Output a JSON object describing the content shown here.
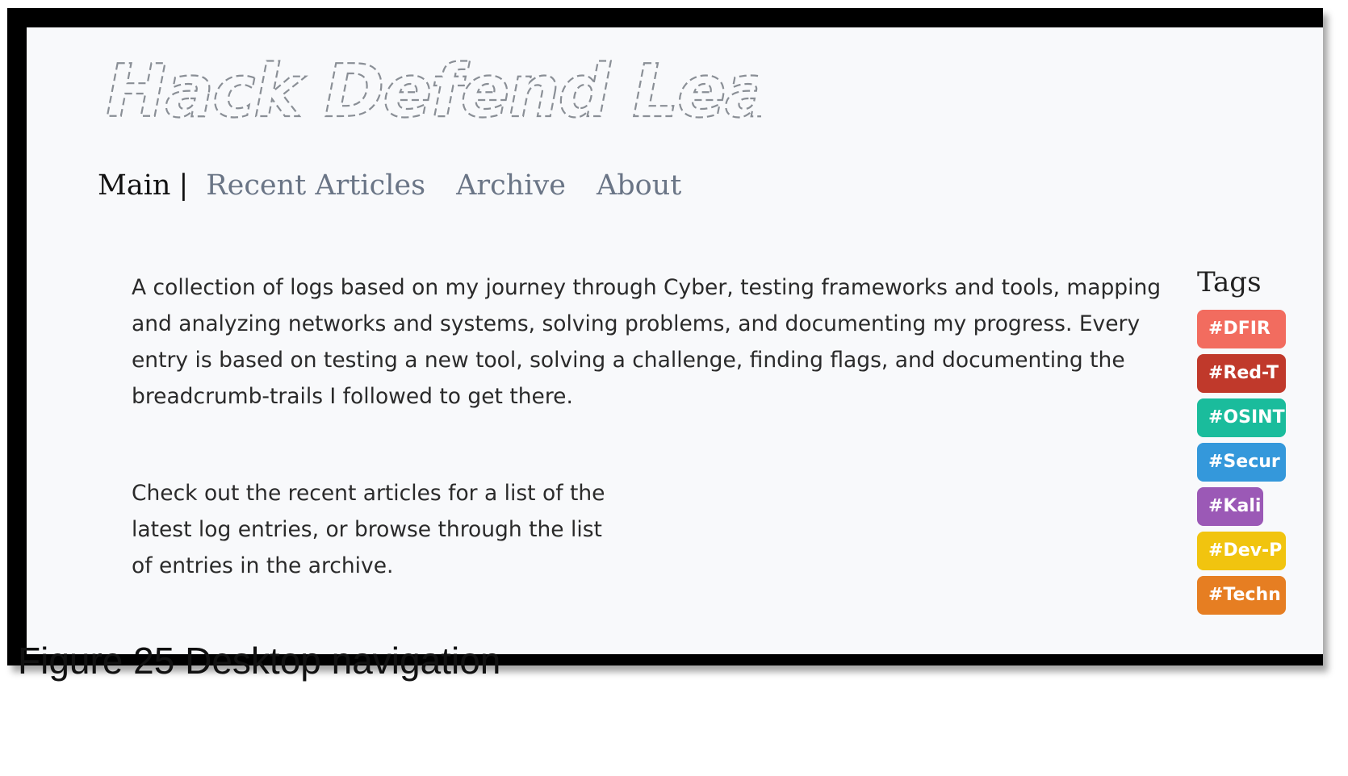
{
  "header": {
    "logo_text": "Hack Defend Learn"
  },
  "nav": {
    "items": [
      {
        "label": "Main",
        "active": true
      },
      {
        "label": "Recent Articles",
        "active": false
      },
      {
        "label": "Archive",
        "active": false
      },
      {
        "label": "About",
        "active": false
      }
    ],
    "separator": "|"
  },
  "main": {
    "intro": "A collection of logs based on my journey through Cyber, testing frameworks and tools, mapping and analyzing networks and systems, solving problems, and documenting my progress. Every entry is based on testing a new tool, solving a challenge, finding flags, and documenting the breadcrumb-trails I followed to get there.",
    "cta": "Check out the recent articles for a list of the latest log entries, or browse through the list of entries in the archive."
  },
  "sidebar": {
    "heading": "Tags",
    "tags": [
      {
        "label": "#DFIR",
        "color": "#f26c5f"
      },
      {
        "label": "#Red-T",
        "color": "#c0392b"
      },
      {
        "label": "#OSINT",
        "color": "#1abc9c"
      },
      {
        "label": "#Secur",
        "color": "#3498db"
      },
      {
        "label": "#Kali",
        "color": "#9b59b6"
      },
      {
        "label": "#Dev-P",
        "color": "#f1c40f"
      },
      {
        "label": "#Techn",
        "color": "#e67e22"
      }
    ]
  },
  "caption": "Figure 25 Desktop navigation"
}
